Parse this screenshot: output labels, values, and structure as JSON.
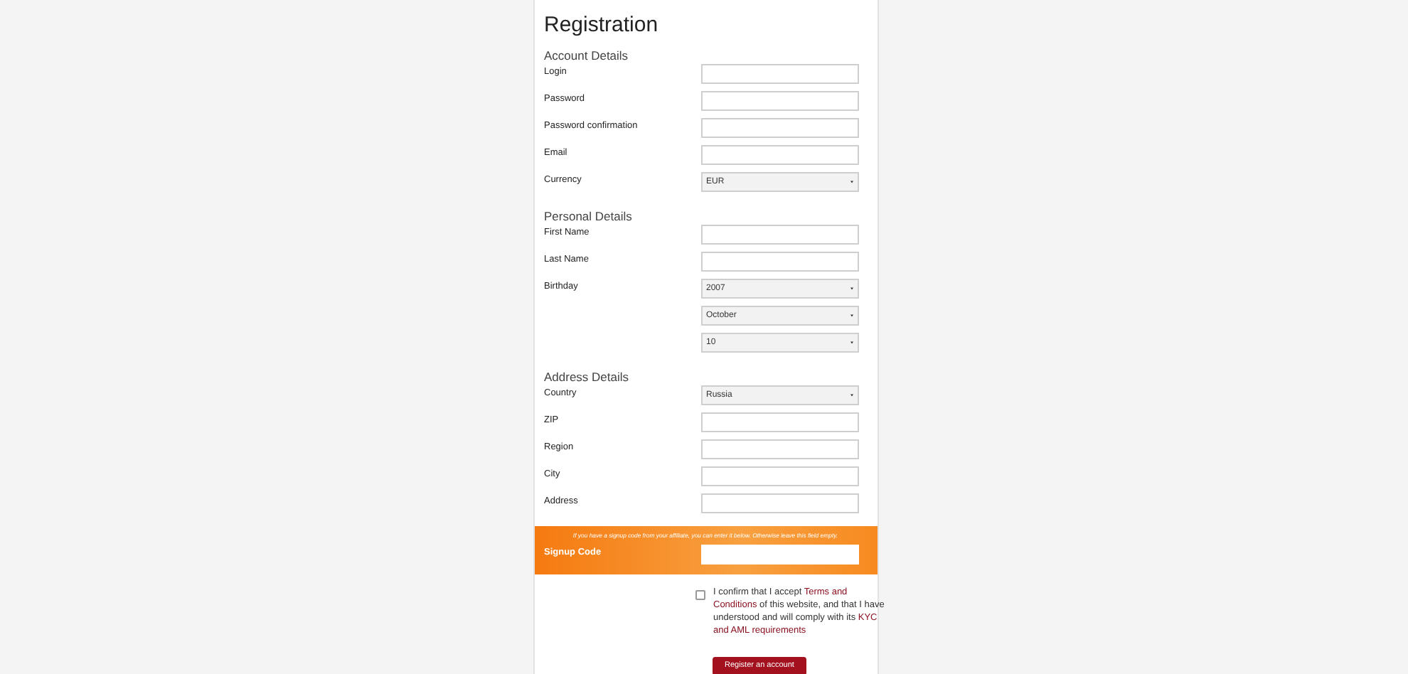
{
  "title": "Registration",
  "sections": [
    {
      "heading": "Account Details",
      "fields": [
        {
          "kind": "text",
          "label": "Login"
        },
        {
          "kind": "text",
          "label": "Password"
        },
        {
          "kind": "text",
          "label": "Password confirmation"
        },
        {
          "kind": "text",
          "label": "Email"
        },
        {
          "kind": "select",
          "label": "Currency",
          "value": "EUR"
        }
      ]
    },
    {
      "heading": "Personal Details",
      "fields": [
        {
          "kind": "text",
          "label": "First Name"
        },
        {
          "kind": "text",
          "label": "Last Name"
        },
        {
          "kind": "select",
          "label": "Birthday",
          "value": "2007"
        },
        {
          "kind": "select",
          "value": "October"
        },
        {
          "kind": "select",
          "value": "10"
        }
      ]
    },
    {
      "heading": "Address Details",
      "fields": [
        {
          "kind": "select",
          "label": "Country",
          "value": "Russia"
        },
        {
          "kind": "text",
          "label": "ZIP"
        },
        {
          "kind": "text",
          "label": "Region"
        },
        {
          "kind": "text",
          "label": "City"
        },
        {
          "kind": "text",
          "label": "Address"
        }
      ]
    }
  ],
  "signup": {
    "hint": "If you have a signup code from your affiliate, you can enter it below. Otherwise leave this field empty.",
    "label": "Signup Code"
  },
  "consent": {
    "checked": false,
    "lines": [
      {
        "parts": [
          {
            "text": "I confirm that I accept ",
            "link": false
          },
          {
            "text": "Terms and",
            "link": true
          }
        ]
      },
      {
        "parts": [
          {
            "text": "Conditions",
            "link": true
          },
          {
            "text": " of this website, and that I have",
            "link": false
          }
        ]
      },
      {
        "parts": [
          {
            "text": "understood and will comply with its ",
            "link": false
          },
          {
            "text": "KYC",
            "link": true
          }
        ]
      },
      {
        "parts": [
          {
            "text": "and AML requirements",
            "link": true
          }
        ]
      }
    ]
  },
  "submit": "Register an account"
}
